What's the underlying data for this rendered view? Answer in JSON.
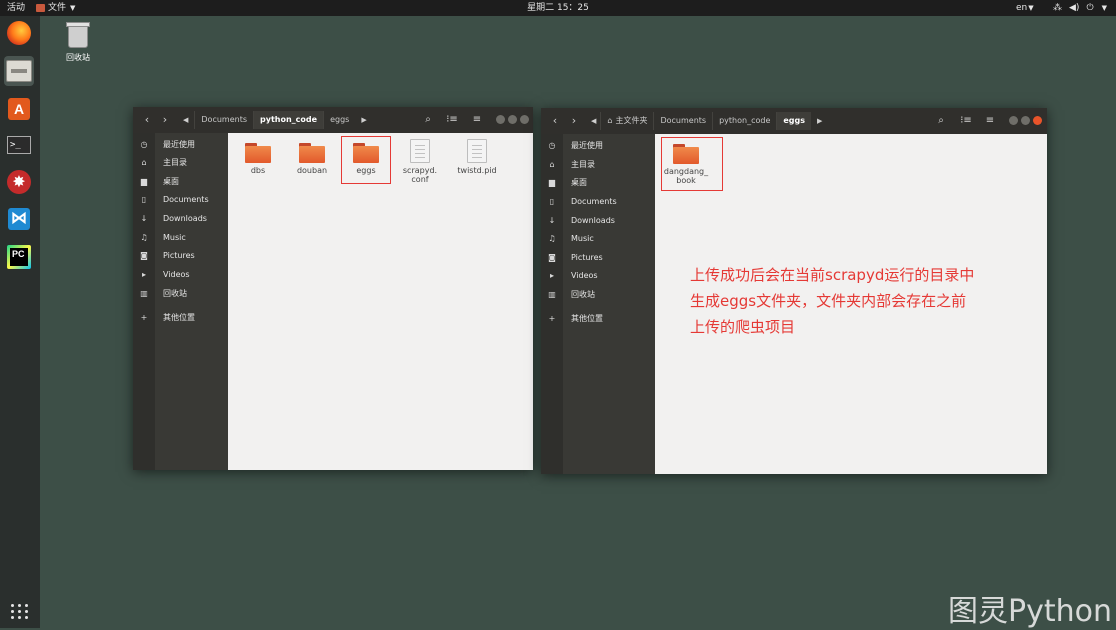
{
  "topbar": {
    "activities": "活动",
    "app_menu": "文件",
    "clock": "星期二 15：25",
    "lang": "en"
  },
  "desktop": {
    "trash_label": "回收站"
  },
  "window_left": {
    "breadcrumbs": [
      "Documents",
      "python_code",
      "eggs"
    ],
    "current": "python_code",
    "sidebar": [
      "最近使用",
      "主目录",
      "桌面",
      "Documents",
      "Downloads",
      "Music",
      "Pictures",
      "Videos",
      "回收站",
      "其他位置"
    ],
    "files": [
      {
        "name": "dbs",
        "type": "folder"
      },
      {
        "name": "douban",
        "type": "folder"
      },
      {
        "name": "eggs",
        "type": "folder"
      },
      {
        "name": "scrapyd.\nconf",
        "type": "file"
      },
      {
        "name": "twistd.pid",
        "type": "file"
      }
    ]
  },
  "window_right": {
    "breadcrumbs": [
      "主文件夹",
      "Documents",
      "python_code",
      "eggs"
    ],
    "current": "eggs",
    "sidebar": [
      "最近使用",
      "主目录",
      "桌面",
      "Documents",
      "Downloads",
      "Music",
      "Pictures",
      "Videos",
      "回收站",
      "其他位置"
    ],
    "files": [
      {
        "name": "dangdang_\nbook",
        "type": "folder"
      }
    ]
  },
  "annotation": [
    "上传成功后会在当前scrapyd运行的目录中",
    "生成eggs文件夹，文件夹内部会存在之前",
    "上传的爬虫项目"
  ],
  "watermark": "图灵Python",
  "colors": {
    "highlight": "#e53935",
    "folder": "#e2592b",
    "desktop": "#3d4f47"
  }
}
